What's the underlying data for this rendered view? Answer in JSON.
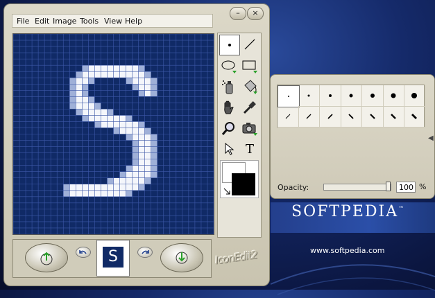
{
  "app": {
    "title_watermark": "SOFTPEDIA"
  },
  "menu": [
    "File",
    "Edit",
    "Image",
    "Tools",
    "View",
    "Help"
  ],
  "window_controls": {
    "minimize": "–",
    "close": "×"
  },
  "tools": [
    {
      "name": "pencil-tool",
      "icon": "dot-icon"
    },
    {
      "name": "line-tool",
      "icon": "line-icon"
    },
    {
      "name": "ellipse-tool",
      "icon": "ellipse-icon"
    },
    {
      "name": "rectangle-tool",
      "icon": "rectangle-icon"
    },
    {
      "name": "spray-tool",
      "icon": "spray-icon"
    },
    {
      "name": "fill-tool",
      "icon": "bucket-icon"
    },
    {
      "name": "hand-tool",
      "icon": "hand-icon"
    },
    {
      "name": "color-picker-tool",
      "icon": "eyedropper-icon"
    },
    {
      "name": "zoom-tool",
      "icon": "magnifier-icon"
    },
    {
      "name": "capture-tool",
      "icon": "camera-icon"
    },
    {
      "name": "select-tool",
      "icon": "arrow-icon"
    },
    {
      "name": "text-tool",
      "icon": "text-icon"
    }
  ],
  "text_tool_glyph": "T",
  "colors": {
    "primary": "#000000",
    "secondary": "#ffffff",
    "canvas_bg": "#102a66",
    "grid_line": "#3d58a8"
  },
  "preview": {
    "glyph": "S"
  },
  "logo": "IconEdit2",
  "brush_panel": {
    "opacity_label": "Opacity:",
    "opacity_value": "100",
    "opacity_unit": "%",
    "opacity_fraction": 1.0,
    "brushes_row1": [
      "dot-1",
      "dot-2",
      "dot-3",
      "dot-4",
      "dot-5",
      "dot-6",
      "dot-7"
    ],
    "brushes_row2": [
      "slash-1",
      "slash-2",
      "slash-3",
      "slash-4",
      "slash-5",
      "slash-6",
      "slash-7"
    ]
  },
  "background": {
    "brand": "SOFTPEDIA",
    "trademark": "™",
    "url": "www.softpedia.com"
  }
}
